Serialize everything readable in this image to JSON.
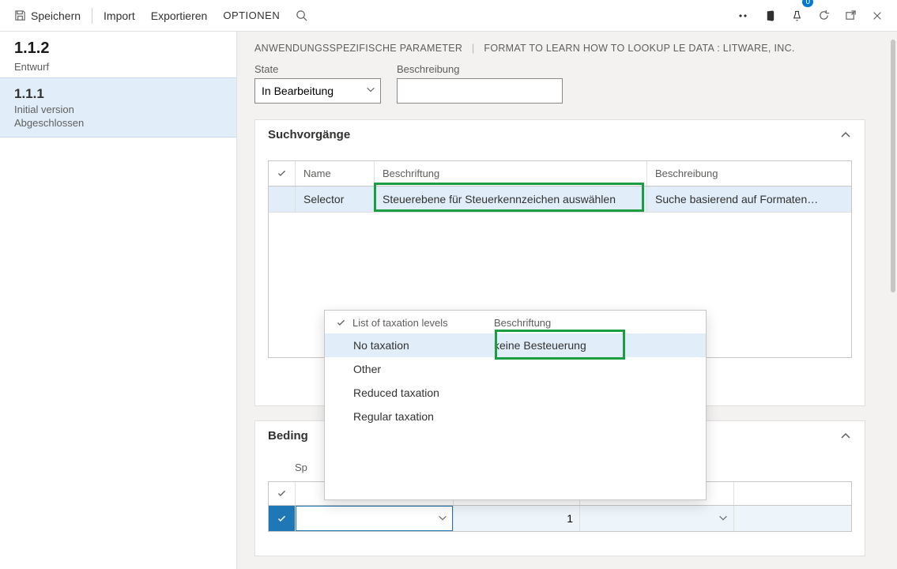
{
  "toolbar": {
    "save": "Speichern",
    "import": "Import",
    "export": "Exportieren",
    "options": "OPTIONEN"
  },
  "notify_badge": "0",
  "sidebar": {
    "current": {
      "version": "1.1.2",
      "status": "Entwurf"
    },
    "items": [
      {
        "version": "1.1.1",
        "line1": "Initial version",
        "line2": "Abgeschlossen"
      }
    ]
  },
  "breadcrumb": {
    "a": "ANWENDUNGSSPEZIFISCHE PARAMETER",
    "b": "FORMAT TO LEARN HOW TO LOOKUP LE DATA : LITWARE, INC."
  },
  "fields": {
    "state_label": "State",
    "state_value": "In Bearbeitung",
    "desc_label": "Beschreibung",
    "desc_value": ""
  },
  "lookups_panel": {
    "title": "Suchvorgänge",
    "columns": {
      "name": "Name",
      "label": "Beschriftung",
      "desc": "Beschreibung"
    },
    "rows": [
      {
        "name": "Selector",
        "label": "Steuerebene für Steuerkennzeichen auswählen",
        "desc": "Suche basierend auf Formaten…"
      }
    ]
  },
  "flyout": {
    "col_a": "List of taxation levels",
    "col_b": "Beschriftung",
    "rows": [
      {
        "a": "No taxation",
        "b": "keine Besteuerung",
        "selected": true
      },
      {
        "a": "Other",
        "b": ""
      },
      {
        "a": "Reduced taxation",
        "b": ""
      },
      {
        "a": "Regular taxation",
        "b": ""
      }
    ]
  },
  "conditions_panel": {
    "title_fragment": "Beding",
    "sp_fragment": "Sp",
    "row": {
      "input": "",
      "num": "1"
    }
  }
}
